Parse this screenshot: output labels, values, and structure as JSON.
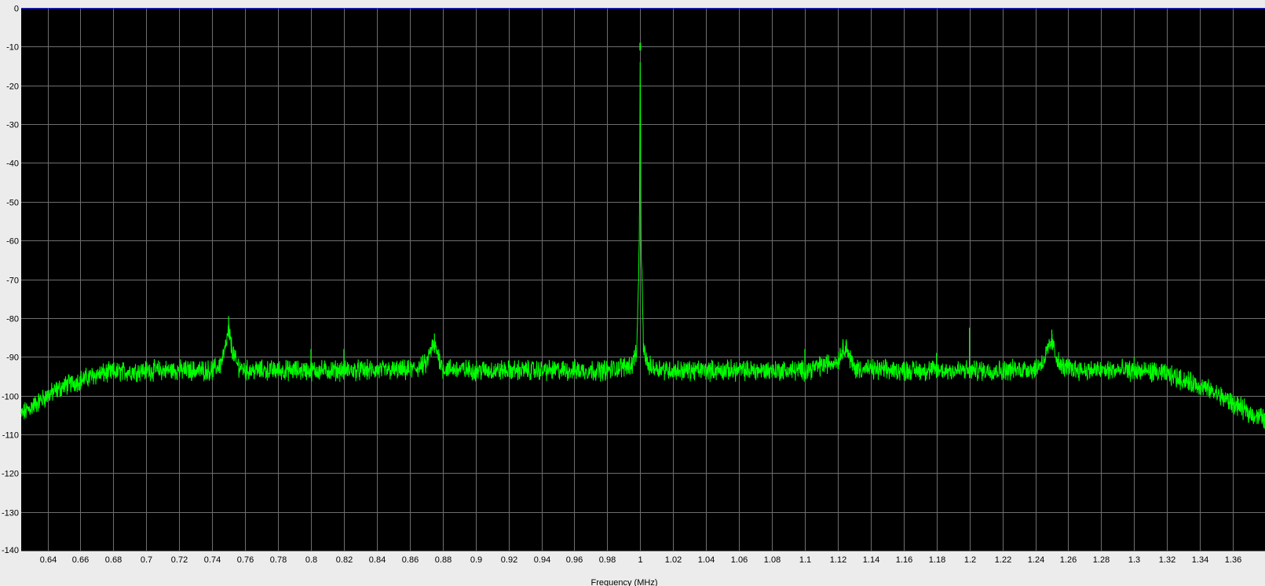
{
  "chart_data": {
    "type": "line",
    "title": "",
    "xlabel": "Frequency (MHz)",
    "ylabel": "",
    "xlim": [
      0.624,
      1.3795
    ],
    "ylim": [
      -140,
      0
    ],
    "grid": true,
    "x_ticks": [
      0.64,
      0.66,
      0.68,
      0.7,
      0.72,
      0.74,
      0.76,
      0.78,
      0.8,
      0.82,
      0.84,
      0.86,
      0.88,
      0.9,
      0.92,
      0.94,
      0.96,
      0.98,
      1,
      1.02,
      1.04,
      1.06,
      1.08,
      1.1,
      1.12,
      1.14,
      1.16,
      1.18,
      1.2,
      1.22,
      1.24,
      1.26,
      1.28,
      1.3,
      1.32,
      1.34,
      1.36
    ],
    "x_tick_labels": [
      "0.64",
      "0.66",
      "0.68",
      "0.7",
      "0.72",
      "0.74",
      "0.76",
      "0.78",
      "0.8",
      "0.82",
      "0.84",
      "0.86",
      "0.88",
      "0.9",
      "0.92",
      "0.94",
      "0.96",
      "0.98",
      "1",
      "1.02",
      "1.04",
      "1.06",
      "1.08",
      "1.1",
      "1.12",
      "1.14",
      "1.16",
      "1.18",
      "1.2",
      "1.22",
      "1.24",
      "1.26",
      "1.28",
      "1.3",
      "1.32",
      "1.34",
      "1.36"
    ],
    "y_ticks": [
      0,
      -10,
      -20,
      -30,
      -40,
      -50,
      -60,
      -70,
      -80,
      -90,
      -100,
      -110,
      -120,
      -130,
      -140
    ],
    "y_tick_labels": [
      "0",
      "-10",
      "-20",
      "-30",
      "-40",
      "-50",
      "-60",
      "-70",
      "-80",
      "-90",
      "-100",
      "-110",
      "-120",
      "-130",
      "-140"
    ],
    "reference_level": 0,
    "series": [
      {
        "color": "#00ff00",
        "x": [
          0.624,
          0.63,
          0.64,
          0.65,
          0.66,
          0.67,
          0.68,
          0.7,
          0.72,
          0.74,
          0.745,
          0.748,
          0.75,
          0.752,
          0.755,
          0.76,
          0.78,
          0.8,
          0.82,
          0.84,
          0.86,
          0.87,
          0.873,
          0.875,
          0.877,
          0.88,
          0.9,
          0.92,
          0.94,
          0.96,
          0.98,
          0.995,
          0.998,
          0.9995,
          1.0,
          1.0005,
          1.002,
          1.005,
          1.02,
          1.04,
          1.06,
          1.08,
          1.1,
          1.12,
          1.123,
          1.125,
          1.127,
          1.13,
          1.15,
          1.18,
          1.2,
          1.22,
          1.24,
          1.245,
          1.248,
          1.25,
          1.252,
          1.255,
          1.27,
          1.29,
          1.31,
          1.32,
          1.33,
          1.34,
          1.35,
          1.36,
          1.37,
          1.3795
        ],
        "y": [
          -105,
          -103,
          -100,
          -97.5,
          -96,
          -94.5,
          -94,
          -93.5,
          -93.5,
          -93.5,
          -92,
          -88,
          -83,
          -88,
          -92,
          -93.5,
          -93.5,
          -93.5,
          -93.5,
          -93.5,
          -93.5,
          -92,
          -88,
          -87,
          -89,
          -93,
          -93.5,
          -93.5,
          -93.5,
          -93.5,
          -93.5,
          -92,
          -88,
          -60,
          -9,
          -60,
          -88,
          -92.5,
          -93.5,
          -93.5,
          -93.5,
          -93.5,
          -93.5,
          -91,
          -88,
          -87,
          -90,
          -93,
          -93.5,
          -93.5,
          -93.5,
          -93.5,
          -93,
          -91,
          -88,
          -86,
          -89,
          -92.5,
          -93.5,
          -93.5,
          -93.8,
          -94.5,
          -96,
          -97.5,
          -99.5,
          -102,
          -104.5,
          -106
        ]
      }
    ],
    "spurs": [
      {
        "x": 0.75,
        "y": -79.5
      },
      {
        "x": 0.8,
        "y": -88
      },
      {
        "x": 0.82,
        "y": -88
      },
      {
        "x": 0.875,
        "y": -84
      },
      {
        "x": 1.0,
        "y": -9
      },
      {
        "x": 1.1,
        "y": -88
      },
      {
        "x": 1.125,
        "y": -86
      },
      {
        "x": 1.18,
        "y": -89
      },
      {
        "x": 1.2,
        "y": -82.5
      },
      {
        "x": 1.25,
        "y": -83
      },
      {
        "x": 1.3,
        "y": -90
      }
    ]
  }
}
